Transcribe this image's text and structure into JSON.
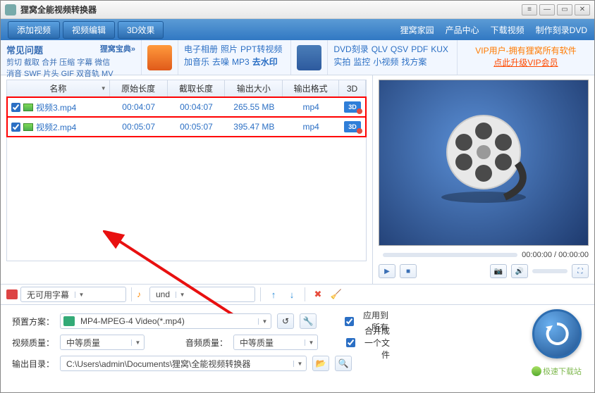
{
  "title": "狸窝全能视频转换器",
  "toolbar": {
    "add": "添加视频",
    "edit": "视频编辑",
    "fx3d": "3D效果"
  },
  "nav": {
    "home": "狸窝家园",
    "products": "产品中心",
    "download": "下载视频",
    "burn": "制作刻录DVD"
  },
  "faq": {
    "title": "常见问题",
    "sub": "狸窝宝典»",
    "line1": "剪切 截取 合并 压缩 字幕 微信",
    "line2": "消音 SWF 片头 GIF 双音轨 MV"
  },
  "links1": {
    "a": "电子相册",
    "b": "照片",
    "c": "PPT转视频",
    "d": "加音乐",
    "e": "去噪",
    "f": "MP3",
    "g": "去水印"
  },
  "links2": {
    "a": "DVD刻录",
    "b": "QLV",
    "c": "QSV",
    "d": "PDF",
    "e": "KUX",
    "f": "实拍",
    "g": "监控",
    "h": "小视频",
    "i": "找方案"
  },
  "vip": {
    "l1": "VIP用户-拥有狸窝所有软件",
    "l2": "点此升级VIP会员"
  },
  "table": {
    "headers": {
      "name": "名称",
      "orig": "原始长度",
      "crop": "截取长度",
      "size": "输出大小",
      "fmt": "输出格式",
      "d3": "3D"
    },
    "rows": [
      {
        "name": "视频3.mp4",
        "orig": "00:04:07",
        "crop": "00:04:07",
        "size": "265.55 MB",
        "fmt": "mp4",
        "d3": "3D"
      },
      {
        "name": "视频2.mp4",
        "orig": "00:05:07",
        "crop": "00:05:07",
        "size": "395.47 MB",
        "fmt": "mp4",
        "d3": "3D"
      }
    ]
  },
  "subtitle": {
    "none": "无可用字幕",
    "lang": "und"
  },
  "preview": {
    "time_cur": "00:00:00",
    "time_total": "00:00:00"
  },
  "settings": {
    "preset_label": "预置方案：",
    "preset_value": "MP4-MPEG-4 Video(*.mp4)",
    "vq_label": "视频质量：",
    "vq_value": "中等质量",
    "aq_label": "音频质量：",
    "aq_value": "中等质量",
    "out_label": "输出目录：",
    "out_value": "C:\\Users\\admin\\Documents\\狸窝\\全能视频转换器",
    "apply_all": "应用到所有",
    "merge": "合并成一个文件"
  },
  "watermark": "极速下载站"
}
